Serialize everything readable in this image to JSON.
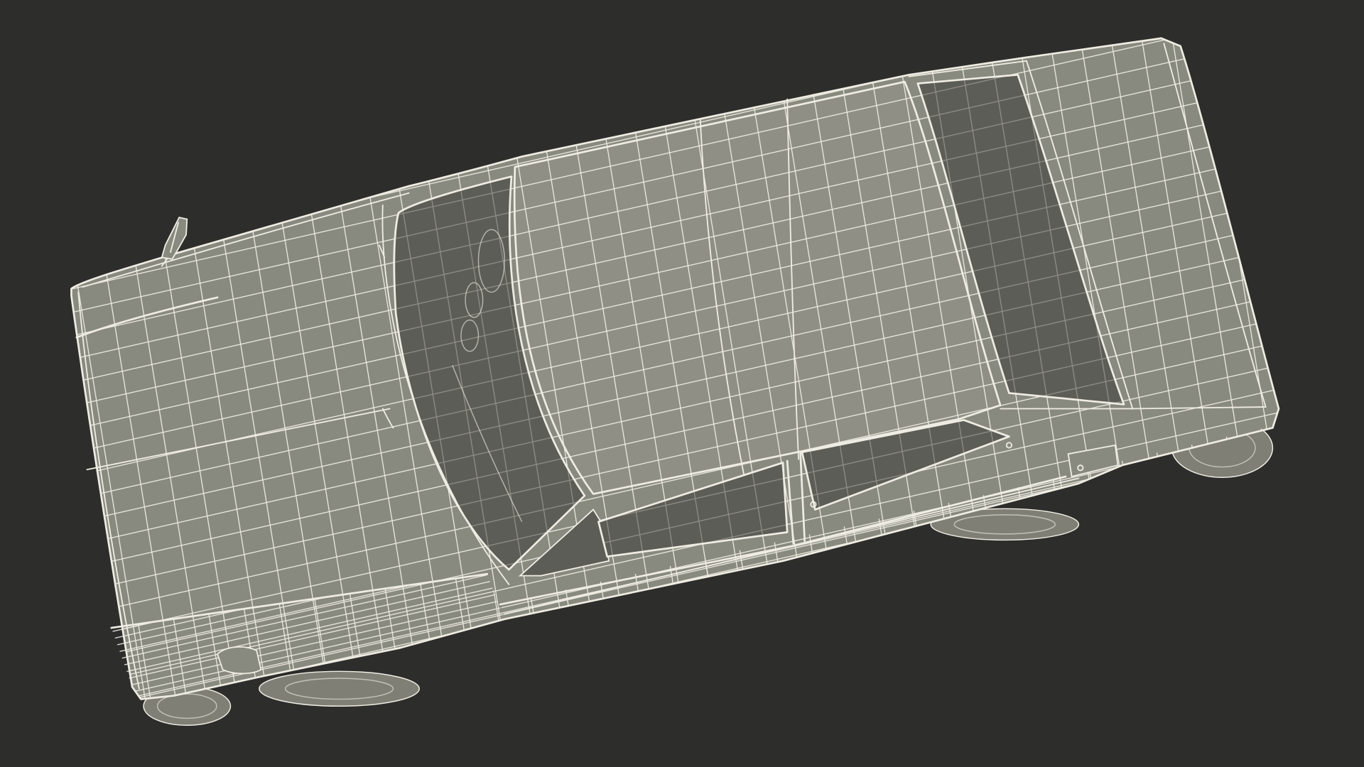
{
  "colors": {
    "background": "#2d2d2b",
    "body": "#898a7f",
    "wire": "#efede3",
    "glass": "#5d5d57",
    "tire": "#7f7f76"
  }
}
